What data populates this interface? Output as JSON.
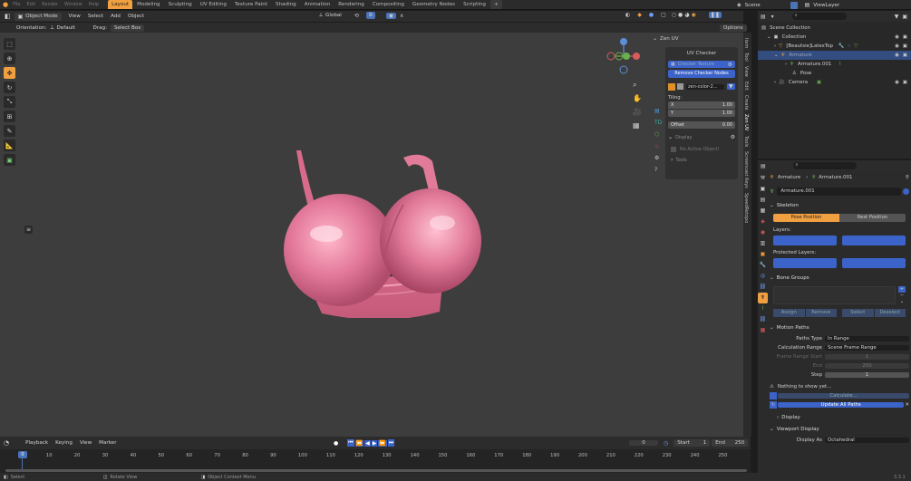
{
  "topbar": {
    "menus": [
      "File",
      "Edit",
      "Render",
      "Window",
      "Help"
    ],
    "workspaces": [
      "Layout",
      "Modeling",
      "Sculpting",
      "UV Editing",
      "Texture Paint",
      "Shading",
      "Animation",
      "Rendering",
      "Compositing",
      "Geometry Nodes",
      "Scripting"
    ],
    "add_tab": "+",
    "scene": "Scene",
    "view_layer": "ViewLayer"
  },
  "viewport_header": {
    "mode": "Object Mode",
    "menus": [
      "View",
      "Select",
      "Add",
      "Object"
    ],
    "transform": "Global",
    "orientation_label": "Orientation:",
    "orientation_value": "Default",
    "drag_label": "Drag:",
    "drag_value": "Select Box",
    "options": "Options"
  },
  "zen_uv": {
    "title": "Zen UV",
    "uv_checker": "UV Checker",
    "checker_texture": "Checker Texture",
    "remove_checker": "Remove Checker Nodes",
    "texture_name": "zen-color-2...",
    "tiling": "Tiling:",
    "x_label": "X",
    "x_value": "1.00",
    "y_label": "Y",
    "y_value": "1.00",
    "offset_label": "Offset",
    "offset_value": "0.00",
    "display": "Display",
    "no_active": "No Active Object!",
    "tools": "Tools"
  },
  "side_tabs": [
    "Item",
    "Tool",
    "View",
    "Edit",
    "Create",
    "Zen UV",
    "Tools",
    "Screencast Keys",
    "SpeedRetopo"
  ],
  "timeline": {
    "menus": [
      "Playback",
      "Keying",
      "View",
      "Marker"
    ],
    "current_frame": "0",
    "start_label": "Start",
    "start_value": "1",
    "end_label": "End",
    "end_value": "250",
    "ticks": [
      "0",
      "10",
      "20",
      "30",
      "40",
      "50",
      "60",
      "70",
      "80",
      "90",
      "100",
      "110",
      "120",
      "130",
      "140",
      "150",
      "160",
      "170",
      "180",
      "190",
      "200",
      "210",
      "220",
      "230",
      "240",
      "250"
    ]
  },
  "status": {
    "select": "Select",
    "rotate": "Rotate View",
    "context": "Object Context Menu",
    "version": "3.3.1"
  },
  "outliner": {
    "root": "Scene Collection",
    "collection": "Collection",
    "mesh": "[Beautsie]LatexTop",
    "armature": "Armature",
    "armature_data": "Armature.001",
    "pose": "Pose",
    "camera": "Camera"
  },
  "properties": {
    "breadcrumb_obj": "Armature",
    "breadcrumb_data": "Armature.001",
    "data_name": "Armature.001",
    "skeleton": "Skeleton",
    "pose_position": "Pose Position",
    "rest_position": "Rest Position",
    "layers": "Layers:",
    "protected_layers": "Protected Layers:",
    "bone_groups": "Bone Groups",
    "assign": "Assign",
    "remove": "Remove",
    "select": "Select",
    "deselect": "Deselect",
    "motion_paths": "Motion Paths",
    "paths_type_label": "Paths Type",
    "paths_type_value": "In Range",
    "calc_range_label": "Calculation Range",
    "calc_range_value": "Scene Frame Range",
    "frame_start_label": "Frame Range Start",
    "frame_start_value": "1",
    "end_label": "End",
    "end_value": "250",
    "step_label": "Step",
    "step_value": "1",
    "nothing": "Nothing to show yet...",
    "calculate": "Calculate...",
    "update_all": "Update All Paths",
    "display": "Display",
    "viewport_display": "Viewport Display",
    "display_as_label": "Display As",
    "display_as_value": "Octahedral"
  },
  "colors": {
    "accent": "#f0a040",
    "blue": "#3b63c9",
    "model": "#e27a9a"
  }
}
